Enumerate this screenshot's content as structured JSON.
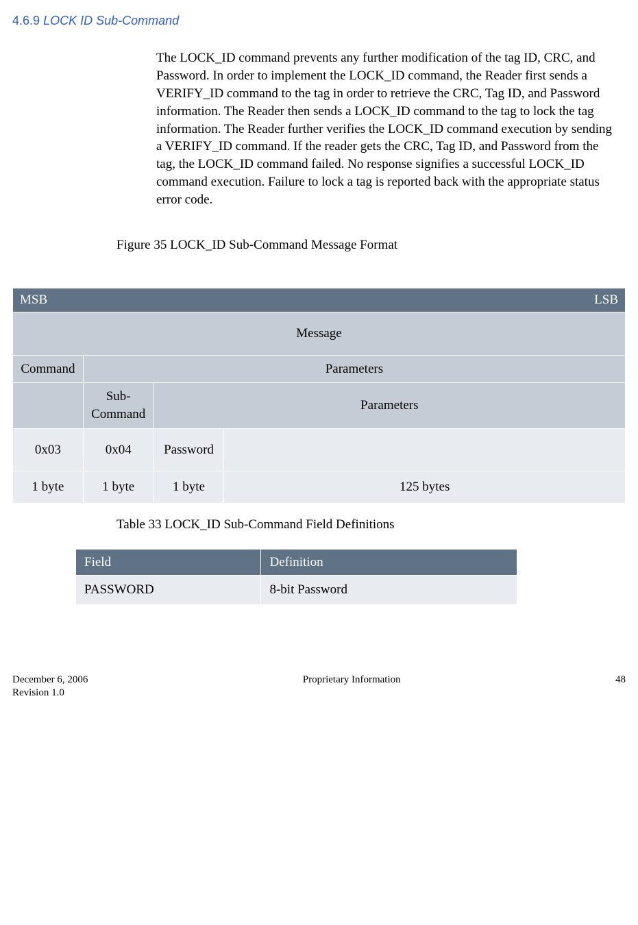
{
  "heading": {
    "number": "4.6.9",
    "title": "LOCK ID Sub-Command"
  },
  "paragraph": "The LOCK_ID command prevents any further modification of the tag ID, CRC, and Password.  In order to implement the LOCK_ID command, the Reader first sends a VERIFY_ID command to the tag in order to retrieve the CRC, Tag ID, and Password information.  The Reader then sends a LOCK_ID command to the tag to lock the tag information.  The Reader further verifies the LOCK_ID command execution by sending a VERIFY_ID command.  If the reader gets the CRC, Tag ID, and Password from the tag, the LOCK_ID command failed.  No response signifies a successful LOCK_ID command execution.  Failure to lock a tag is reported back with the appropriate status error code.",
  "figure_caption": "Figure 35 LOCK_ID Sub-Command Message Format",
  "msg_table": {
    "msb": "MSB",
    "lsb": "LSB",
    "message": "Message",
    "command": "Command",
    "parameters1": "Parameters",
    "sub_command": "Sub-Command",
    "parameters2": "Parameters",
    "val_cmd": "0x03",
    "val_sub": "0x04",
    "val_pw": "Password",
    "size_cmd": "1 byte",
    "size_sub": "1 byte",
    "size_pw": "1 byte",
    "size_rest": "125 bytes"
  },
  "table_caption": "Table 33 LOCK_ID Sub-Command Field Definitions",
  "def_table": {
    "h_field": "Field",
    "h_def": "Definition",
    "r0_field": "PASSWORD",
    "r0_def": "8-bit Password"
  },
  "footer": {
    "date": "December 6, 2006",
    "revision": "Revision 1.0",
    "center": "Proprietary Information",
    "page": "48"
  }
}
